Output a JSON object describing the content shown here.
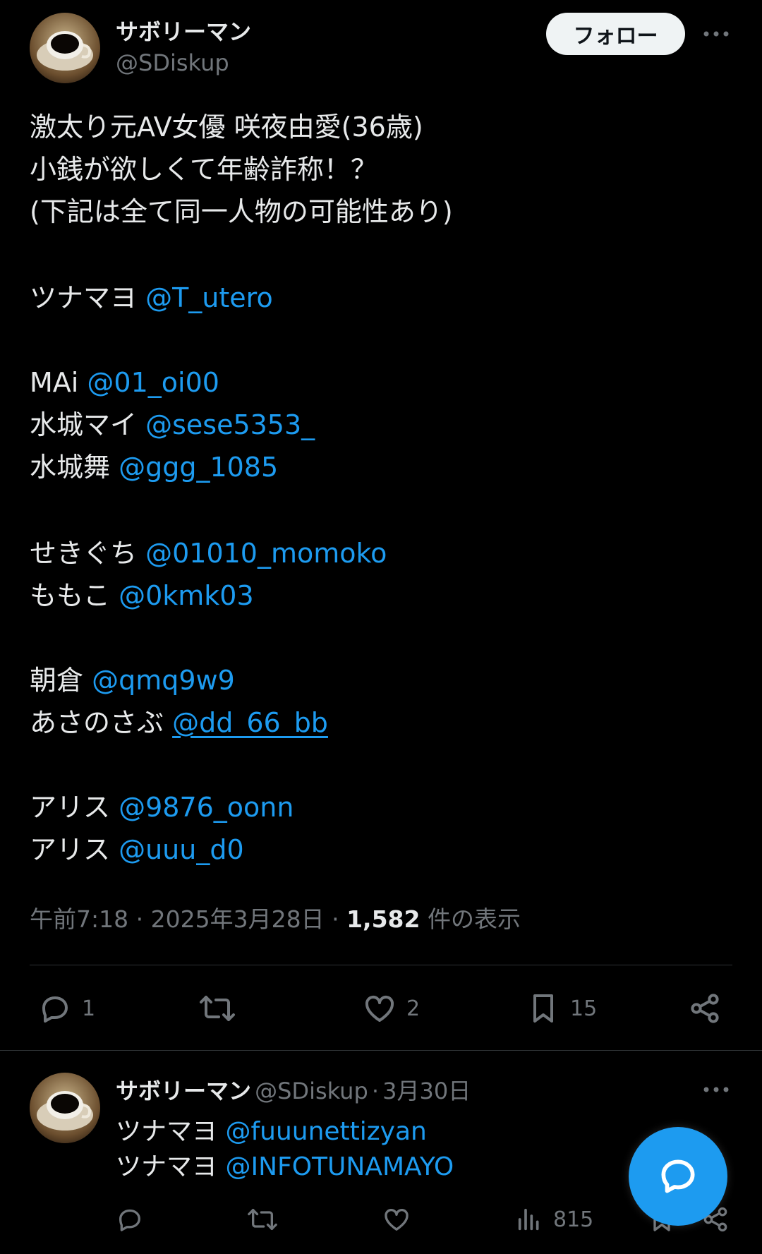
{
  "post": {
    "author": {
      "display_name": "サボリーマン",
      "handle": "@SDiskup"
    },
    "follow_label": "フォロー",
    "lines": [
      {
        "text": "激太り元AV女優 咲夜由愛(36歳)",
        "mention": ""
      },
      {
        "text": "小銭が欲しくて年齢詐称！？",
        "mention": ""
      },
      {
        "text": "(下記は全て同一人物の可能性あり)",
        "mention": ""
      },
      {
        "text": "ツナマヨ ",
        "mention": "@T_utero"
      },
      {
        "text": "MAi ",
        "mention": "@01_oi00"
      },
      {
        "text": "水城マイ ",
        "mention": "@sese5353_"
      },
      {
        "text": "水城舞 ",
        "mention": "@ggg_1085"
      },
      {
        "text": "せきぐち ",
        "mention": "@01010_momoko"
      },
      {
        "text": "ももこ ",
        "mention": "@0kmk03"
      },
      {
        "text": "朝倉 ",
        "mention": "@qmq9w9"
      },
      {
        "text": "あさのさぶ ",
        "mention": "@dd_66_bb"
      },
      {
        "text": "アリス ",
        "mention": "@9876_oonn"
      },
      {
        "text": "アリス ",
        "mention": "@uuu_d0"
      }
    ],
    "meta": {
      "time": "午前7:18",
      "date": "2025年3月28日",
      "views": "1,582",
      "views_suffix": "件の表示",
      "sep": "·"
    },
    "actions": {
      "replies": "1",
      "reposts": "",
      "likes": "2",
      "bookmarks": "15"
    }
  },
  "reply": {
    "author": {
      "display_name": "サボリーマン",
      "handle": "@SDiskup",
      "date": "3月30日",
      "sep": "·"
    },
    "lines": [
      {
        "text": "ツナマヨ ",
        "mention": "@fuuunettizyan"
      },
      {
        "text": "ツナマヨ ",
        "mention": "@INFOTUNAMAYO"
      }
    ],
    "actions": {
      "views": "815"
    }
  },
  "colors": {
    "background": "#000000",
    "text": "#e7e9ea",
    "muted": "#71767b",
    "link": "#1d9bf0",
    "fab": "#1d9bf0"
  },
  "icons": [
    "more-icon",
    "reply-icon",
    "repost-icon",
    "like-icon",
    "bookmark-icon",
    "share-icon",
    "views-icon",
    "compose-message-icon"
  ]
}
